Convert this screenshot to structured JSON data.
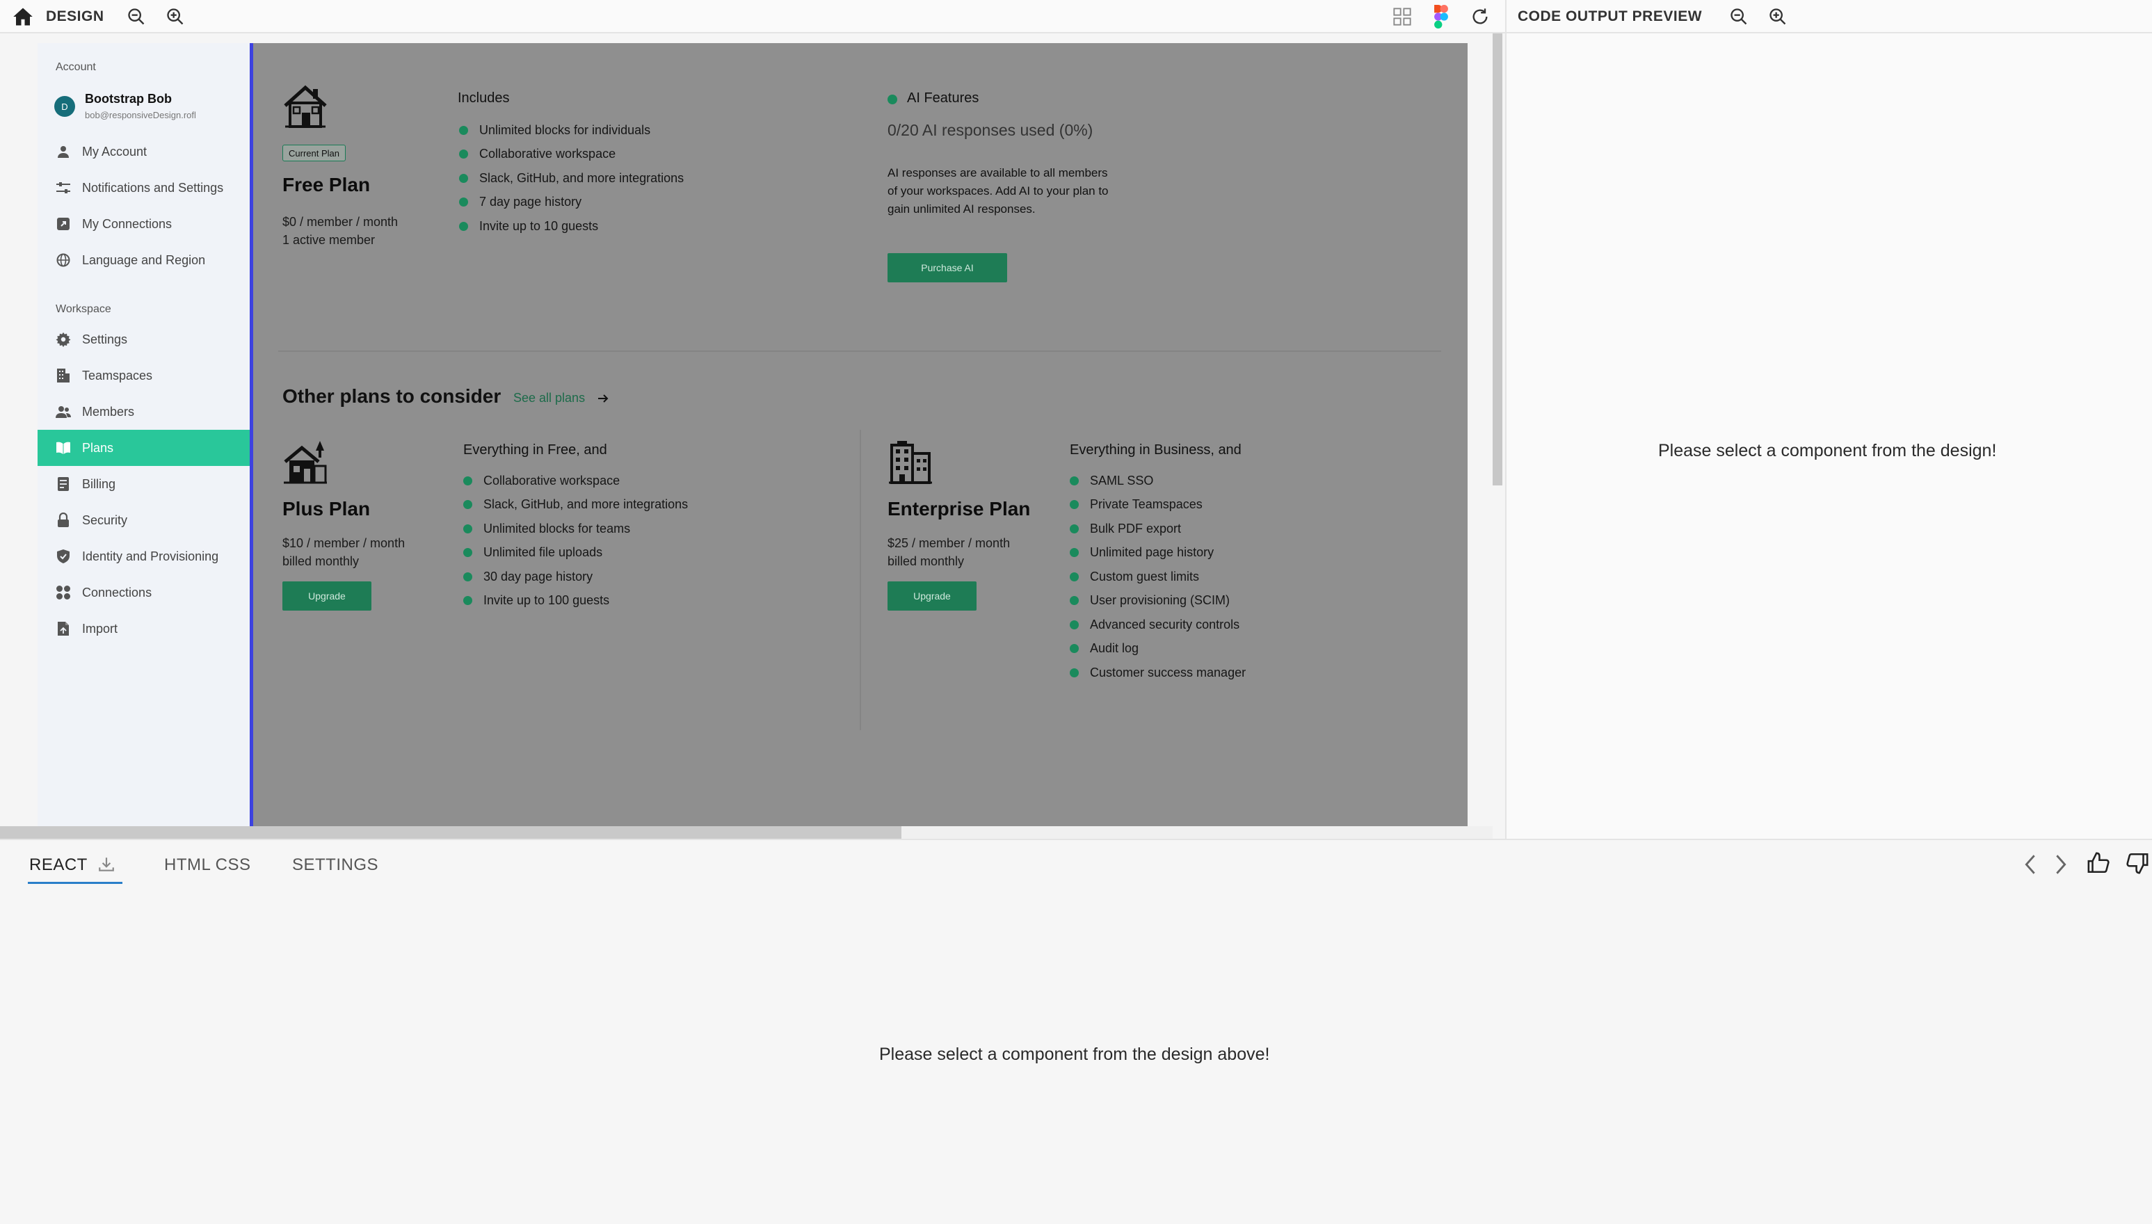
{
  "design_bar": {
    "title": "DESIGN"
  },
  "preview_bar": {
    "title": "CODE OUTPUT PREVIEW"
  },
  "sidebar": {
    "account_label": "Account",
    "user": {
      "avatar_letter": "D",
      "name": "Bootstrap Bob",
      "email": "bob@responsiveDesign.rofl"
    },
    "account_items": [
      {
        "label": "My Account",
        "icon": "user-icon"
      },
      {
        "label": "Notifications and Settings",
        "icon": "sliders-icon"
      },
      {
        "label": "My Connections",
        "icon": "external-link-icon"
      },
      {
        "label": "Language and Region",
        "icon": "globe-icon"
      }
    ],
    "workspace_label": "Workspace",
    "workspace_items": [
      {
        "label": "Settings",
        "icon": "gear-icon"
      },
      {
        "label": "Teamspaces",
        "icon": "building-icon"
      },
      {
        "label": "Members",
        "icon": "users-icon"
      },
      {
        "label": "Plans",
        "icon": "book-icon",
        "active": true
      },
      {
        "label": "Billing",
        "icon": "receipt-icon"
      },
      {
        "label": "Security",
        "icon": "lock-icon"
      },
      {
        "label": "Identity and Provisioning",
        "icon": "shield-icon"
      },
      {
        "label": "Connections",
        "icon": "grid-icon"
      },
      {
        "label": "Import",
        "icon": "file-icon"
      }
    ]
  },
  "current_plan": {
    "badge": "Current Plan",
    "name": "Free Plan",
    "price": "$0 / member / month",
    "members": "1 active member",
    "includes_title": "Includes",
    "includes": [
      "Unlimited blocks for individuals",
      "Collaborative workspace",
      "Slack, GitHub, and more integrations",
      "7 day page history",
      "Invite up to 10 guests"
    ]
  },
  "ai": {
    "title": "AI Features",
    "usage": "0/20 AI responses used (0%)",
    "description": [
      "AI responses are available to all members",
      "of your workspaces. Add AI to your plan to",
      "gain unlimited AI responses."
    ],
    "button": "Purchase AI"
  },
  "other_plans": {
    "title": "Other plans to consider",
    "link": "See all plans",
    "plus": {
      "name": "Plus Plan",
      "price": "$10 / member / month",
      "billing": "billed monthly",
      "button": "Upgrade",
      "features_title": "Everything in Free, and",
      "features": [
        "Collaborative workspace",
        "Slack, GitHub, and more integrations",
        "Unlimited blocks for teams",
        "Unlimited file uploads",
        "30 day page history",
        "Invite up to 100 guests"
      ]
    },
    "enterprise": {
      "name": "Enterprise Plan",
      "price": "$25 / member / month",
      "billing": "billed monthly",
      "button": "Upgrade",
      "features_title": "Everything in Business, and",
      "features": [
        "SAML SSO",
        "Private Teamspaces",
        "Bulk PDF export",
        "Unlimited page history",
        "Custom guest limits",
        "User provisioning (SCIM)",
        "Advanced security controls",
        "Audit log",
        "Customer success manager"
      ]
    }
  },
  "preview": {
    "message": "Please select a component from the design!"
  },
  "bottom": {
    "tabs": [
      "REACT",
      "HTML CSS",
      "SETTINGS"
    ],
    "message": "Please select a component from the design above!"
  },
  "colors": {
    "accent_green": "#29c79a",
    "button_green": "#1e7c55",
    "frame_border": "#3d42e0"
  }
}
